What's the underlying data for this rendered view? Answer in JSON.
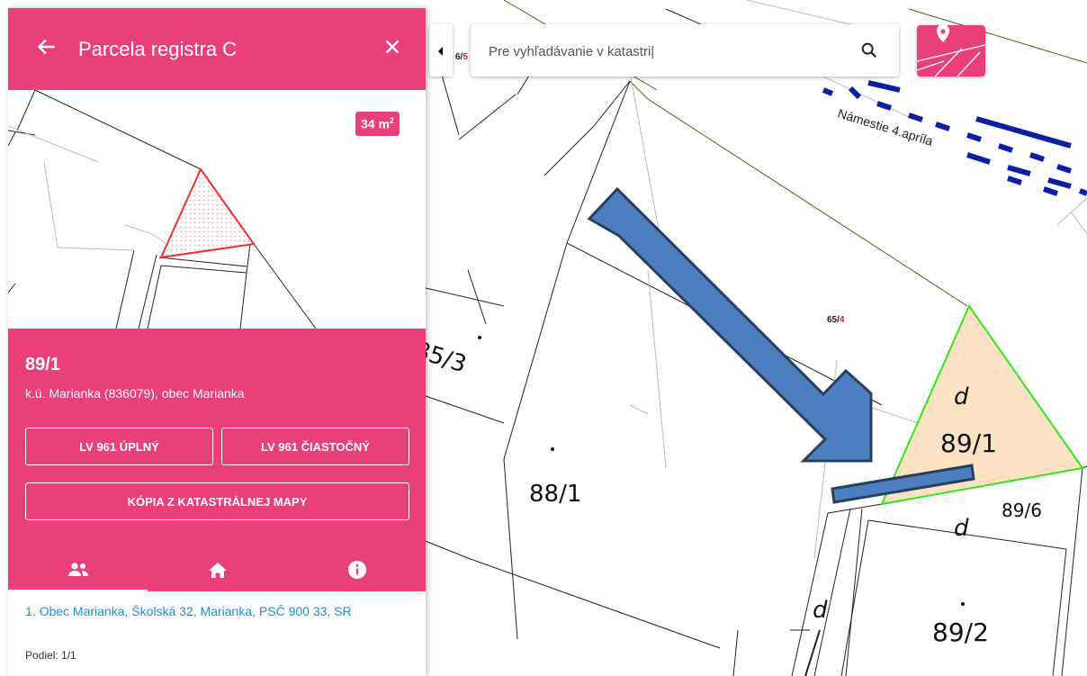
{
  "header": {
    "title": "Parcela registra C"
  },
  "thumbnail": {
    "area_value": "34 m",
    "area_unit_exp": "2"
  },
  "parcel": {
    "number": "89/1",
    "cadastral": "k.ú. Marianka (836079), obec Marianka",
    "buttons": [
      "LV 961 ÚPLNÝ",
      "LV 961 ČIASTOČNÝ",
      "KÓPIA Z KATASTRÁLNEJ MAPY"
    ]
  },
  "tabs": [
    {
      "icon": "people-icon",
      "active": true
    },
    {
      "icon": "home-icon",
      "active": false
    },
    {
      "icon": "info-icon",
      "active": false
    }
  ],
  "owner": {
    "text": "1. Obec Marianka, Školská 32, Marianka, PSČ 900 33, SR",
    "share": "Podiel: 1/1"
  },
  "search": {
    "value": "Pre vyhľadávanie v katastri|"
  },
  "map": {
    "street": "Námestie 4.apríla",
    "top_label_black": "6/",
    "top_label_red": "5",
    "label_65_black": "65/",
    "label_65_red": "4",
    "labels": [
      "85/3",
      "88/1",
      "d",
      "89/1",
      "89/6",
      "d",
      "d",
      "89/2"
    ]
  },
  "colors": {
    "accent": "#e94077",
    "highlight_fill": "#fde2c3",
    "highlight_stroke": "#33e51a",
    "arrow": "#4d7ebf",
    "road": "#0c1fa3"
  }
}
